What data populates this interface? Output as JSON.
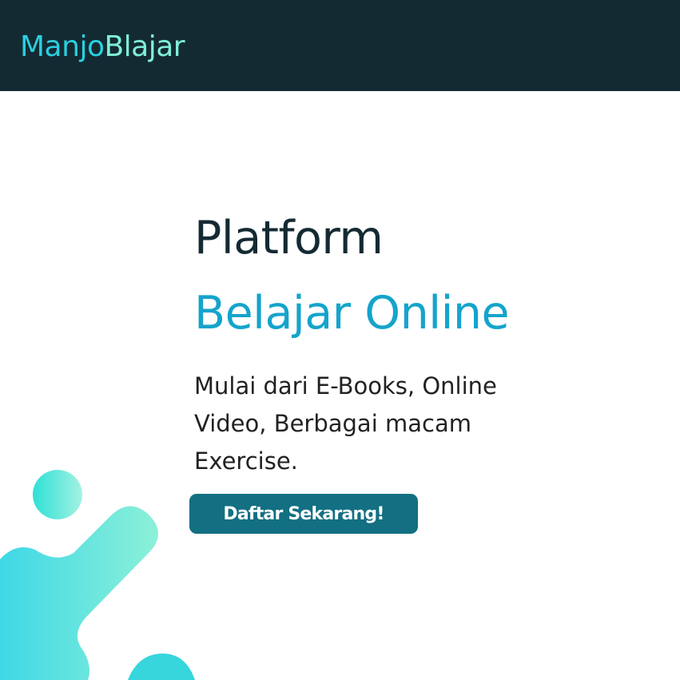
{
  "navbar": {
    "brand_part_1": "Manjo",
    "brand_part_2": "Blajar"
  },
  "hero": {
    "title_line_1": "Platform",
    "title_line_2": "Belajar Online",
    "description": "Mulai dari E-Books, Online Video, Berbagai macam Exercise.",
    "cta_label": "Daftar Sekarang!"
  },
  "colors": {
    "navbar_bg": "#142a33",
    "brand_part_1": "#2ad0e0",
    "brand_part_2": "#7ff0d6",
    "title_dark": "#142a33",
    "title_accent": "#14a4cc",
    "button_bg": "#136f82",
    "decor_start": "#3ed8e6",
    "decor_end": "#8cf0d8"
  },
  "decor": {
    "icon": "abstract-blob-shapes"
  }
}
